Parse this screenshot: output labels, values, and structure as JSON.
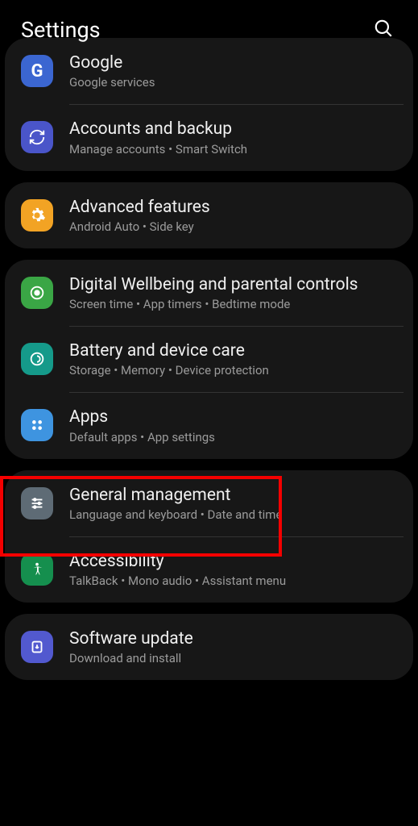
{
  "header": {
    "title": "Settings"
  },
  "groups": [
    {
      "items": [
        {
          "key": "google",
          "title": "Google",
          "subtitle": "Google services",
          "icon": "google-icon",
          "bg": "#3b66d1"
        },
        {
          "key": "accounts",
          "title": "Accounts and backup",
          "subtitle": "Manage accounts  •  Smart Switch",
          "icon": "sync-icon",
          "bg": "#4a55c9"
        }
      ]
    },
    {
      "items": [
        {
          "key": "advanced",
          "title": "Advanced features",
          "subtitle": "Android Auto  •  Side key",
          "icon": "gear-icon",
          "bg": "#f2a324"
        }
      ]
    },
    {
      "items": [
        {
          "key": "wellbeing",
          "title": "Digital Wellbeing and parental controls",
          "subtitle": "Screen time  •  App timers  •  Bedtime mode",
          "icon": "wellbeing-icon",
          "bg": "#3aa645"
        },
        {
          "key": "devicecare",
          "title": "Battery and device care",
          "subtitle": "Storage  •  Memory  •  Device protection",
          "icon": "devicecare-icon",
          "bg": "#159a8a"
        },
        {
          "key": "apps",
          "title": "Apps",
          "subtitle": "Default apps  •  App settings",
          "icon": "apps-icon",
          "bg": "#3e94e0"
        }
      ]
    },
    {
      "items": [
        {
          "key": "general",
          "title": "General management",
          "subtitle": "Language and keyboard  •  Date and time",
          "icon": "sliders-icon",
          "bg": "#5e6b75"
        },
        {
          "key": "accessibility",
          "title": "Accessibility",
          "subtitle": "TalkBack  •  Mono audio  •  Assistant menu",
          "icon": "accessibility-icon",
          "bg": "#158f4e"
        }
      ]
    },
    {
      "items": [
        {
          "key": "software",
          "title": "Software update",
          "subtitle": "Download and install",
          "icon": "update-icon",
          "bg": "#5259cf"
        }
      ]
    }
  ]
}
